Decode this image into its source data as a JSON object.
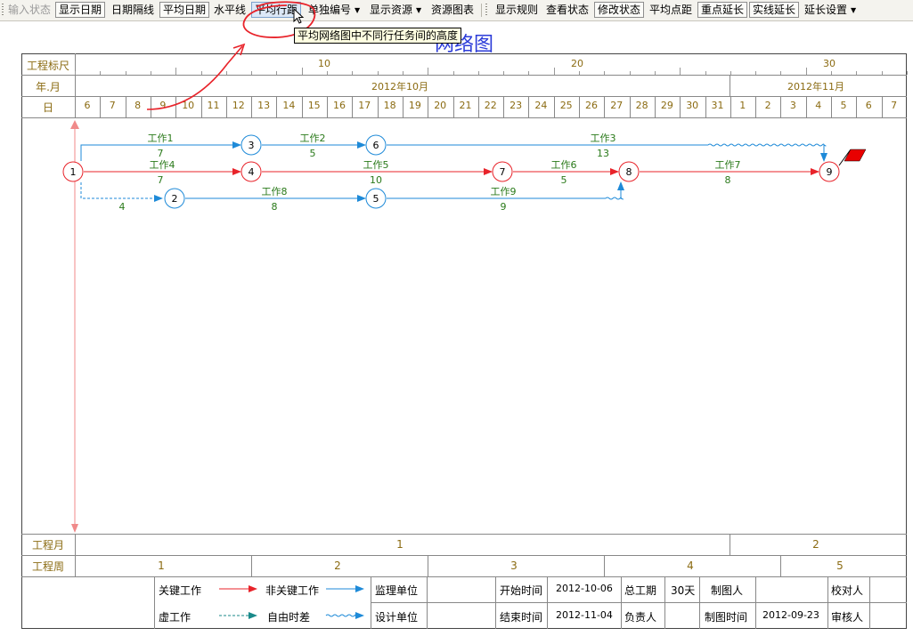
{
  "toolbar": {
    "items": [
      {
        "label": "输入状态",
        "state": "disabled"
      },
      {
        "label": "显示日期",
        "state": "pressed"
      },
      {
        "label": "日期隔线",
        "state": "normal"
      },
      {
        "label": "平均日期",
        "state": "pressed"
      },
      {
        "label": "水平线",
        "state": "normal"
      },
      {
        "label": "平均行距",
        "state": "active"
      },
      {
        "label": "单独编号",
        "state": "dropdown"
      },
      {
        "label": "显示资源",
        "state": "dropdown"
      },
      {
        "label": "资源图表",
        "state": "normal"
      },
      {
        "label": "显示规则",
        "state": "normal"
      },
      {
        "label": "查看状态",
        "state": "normal"
      },
      {
        "label": "修改状态",
        "state": "pressed"
      },
      {
        "label": "平均点距",
        "state": "normal"
      },
      {
        "label": "重点延长",
        "state": "pressed"
      },
      {
        "label": "实线延长",
        "state": "pressed"
      },
      {
        "label": "延长设置",
        "state": "dropdown"
      }
    ]
  },
  "tooltip": "平均网络图中不同行任务间的高度",
  "title": "网络图",
  "header": {
    "scale_label": "工程标尺",
    "scale_marks": [
      "10",
      "20",
      "30"
    ],
    "month_label": "年.月",
    "months": [
      "2012年10月",
      "2012年11月"
    ],
    "day_label": "日",
    "days": [
      "6",
      "7",
      "8",
      "9",
      "10",
      "11",
      "12",
      "13",
      "14",
      "15",
      "16",
      "17",
      "18",
      "19",
      "20",
      "21",
      "22",
      "23",
      "24",
      "25",
      "26",
      "27",
      "28",
      "29",
      "30",
      "31",
      "1",
      "2",
      "3",
      "4",
      "5",
      "6",
      "7"
    ]
  },
  "network": {
    "nodes": [
      {
        "id": "1",
        "critical": true
      },
      {
        "id": "2",
        "critical": false
      },
      {
        "id": "3",
        "critical": false
      },
      {
        "id": "4",
        "critical": true
      },
      {
        "id": "5",
        "critical": false
      },
      {
        "id": "6",
        "critical": false
      },
      {
        "id": "7",
        "critical": true
      },
      {
        "id": "8",
        "critical": true
      },
      {
        "id": "9",
        "critical": true
      }
    ],
    "tasks": [
      {
        "name": "工作1",
        "from": "1",
        "to": "3",
        "duration": "7",
        "type": "non-critical"
      },
      {
        "name": "工作2",
        "from": "3",
        "to": "6",
        "duration": "5",
        "type": "non-critical"
      },
      {
        "name": "工作3",
        "from": "6",
        "to": "9",
        "duration": "13",
        "type": "non-critical"
      },
      {
        "name": "工作4",
        "from": "1",
        "to": "4",
        "duration": "7",
        "type": "critical"
      },
      {
        "name": "工作5",
        "from": "4",
        "to": "7",
        "duration": "10",
        "type": "critical"
      },
      {
        "name": "工作6",
        "from": "7",
        "to": "8",
        "duration": "5",
        "type": "critical"
      },
      {
        "name": "工作7",
        "from": "8",
        "to": "9",
        "duration": "8",
        "type": "critical"
      },
      {
        "name": "工作8",
        "from": "2",
        "to": "5",
        "duration": "8",
        "type": "non-critical"
      },
      {
        "name": "工作9",
        "from": "5",
        "to": "8",
        "duration": "9",
        "type": "non-critical"
      },
      {
        "name": "",
        "from": "1",
        "to": "2",
        "duration": "4",
        "type": "dummy"
      }
    ]
  },
  "footer": {
    "month_row_label": "工程月",
    "months": [
      "1",
      "2"
    ],
    "week_row_label": "工程周",
    "weeks": [
      "1",
      "2",
      "3",
      "4",
      "5"
    ]
  },
  "legend": {
    "critical": "关键工作",
    "non_critical": "非关键工作",
    "dummy": "虚工作",
    "free_float": "自由时差"
  },
  "info": {
    "supervisor_label": "监理单位",
    "design_label": "设计单位",
    "start_label": "开始时间",
    "start_value": "2012-10-06",
    "end_label": "结束时间",
    "end_value": "2012-11-04",
    "duration_label": "总工期",
    "duration_value": "30天",
    "manager_label": "负责人",
    "drafter_label": "制图人",
    "draw_date_label": "制图时间",
    "draw_date_value": "2012-09-23",
    "checker_label": "校对人",
    "reviewer_label": "审核人"
  },
  "colors": {
    "critical": "#e8232a",
    "non_critical": "#1e8ad8",
    "task_label": "#2a7a1a",
    "header_text": "#8b6b12",
    "annotation": "#e8232a"
  }
}
